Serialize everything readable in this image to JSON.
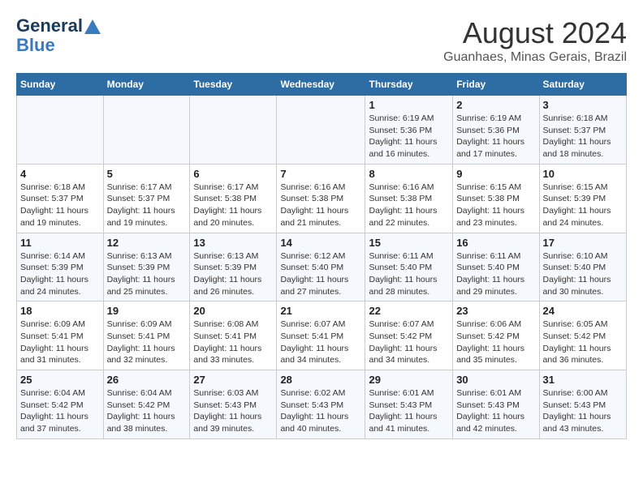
{
  "header": {
    "logo_line1": "General",
    "logo_line2": "Blue",
    "title": "August 2024",
    "subtitle": "Guanhaes, Minas Gerais, Brazil"
  },
  "days_of_week": [
    "Sunday",
    "Monday",
    "Tuesday",
    "Wednesday",
    "Thursday",
    "Friday",
    "Saturday"
  ],
  "weeks": [
    [
      {
        "day": "",
        "info": ""
      },
      {
        "day": "",
        "info": ""
      },
      {
        "day": "",
        "info": ""
      },
      {
        "day": "",
        "info": ""
      },
      {
        "day": "1",
        "info": "Sunrise: 6:19 AM\nSunset: 5:36 PM\nDaylight: 11 hours and 16 minutes."
      },
      {
        "day": "2",
        "info": "Sunrise: 6:19 AM\nSunset: 5:36 PM\nDaylight: 11 hours and 17 minutes."
      },
      {
        "day": "3",
        "info": "Sunrise: 6:18 AM\nSunset: 5:37 PM\nDaylight: 11 hours and 18 minutes."
      }
    ],
    [
      {
        "day": "4",
        "info": "Sunrise: 6:18 AM\nSunset: 5:37 PM\nDaylight: 11 hours and 19 minutes."
      },
      {
        "day": "5",
        "info": "Sunrise: 6:17 AM\nSunset: 5:37 PM\nDaylight: 11 hours and 19 minutes."
      },
      {
        "day": "6",
        "info": "Sunrise: 6:17 AM\nSunset: 5:38 PM\nDaylight: 11 hours and 20 minutes."
      },
      {
        "day": "7",
        "info": "Sunrise: 6:16 AM\nSunset: 5:38 PM\nDaylight: 11 hours and 21 minutes."
      },
      {
        "day": "8",
        "info": "Sunrise: 6:16 AM\nSunset: 5:38 PM\nDaylight: 11 hours and 22 minutes."
      },
      {
        "day": "9",
        "info": "Sunrise: 6:15 AM\nSunset: 5:38 PM\nDaylight: 11 hours and 23 minutes."
      },
      {
        "day": "10",
        "info": "Sunrise: 6:15 AM\nSunset: 5:39 PM\nDaylight: 11 hours and 24 minutes."
      }
    ],
    [
      {
        "day": "11",
        "info": "Sunrise: 6:14 AM\nSunset: 5:39 PM\nDaylight: 11 hours and 24 minutes."
      },
      {
        "day": "12",
        "info": "Sunrise: 6:13 AM\nSunset: 5:39 PM\nDaylight: 11 hours and 25 minutes."
      },
      {
        "day": "13",
        "info": "Sunrise: 6:13 AM\nSunset: 5:39 PM\nDaylight: 11 hours and 26 minutes."
      },
      {
        "day": "14",
        "info": "Sunrise: 6:12 AM\nSunset: 5:40 PM\nDaylight: 11 hours and 27 minutes."
      },
      {
        "day": "15",
        "info": "Sunrise: 6:11 AM\nSunset: 5:40 PM\nDaylight: 11 hours and 28 minutes."
      },
      {
        "day": "16",
        "info": "Sunrise: 6:11 AM\nSunset: 5:40 PM\nDaylight: 11 hours and 29 minutes."
      },
      {
        "day": "17",
        "info": "Sunrise: 6:10 AM\nSunset: 5:40 PM\nDaylight: 11 hours and 30 minutes."
      }
    ],
    [
      {
        "day": "18",
        "info": "Sunrise: 6:09 AM\nSunset: 5:41 PM\nDaylight: 11 hours and 31 minutes."
      },
      {
        "day": "19",
        "info": "Sunrise: 6:09 AM\nSunset: 5:41 PM\nDaylight: 11 hours and 32 minutes."
      },
      {
        "day": "20",
        "info": "Sunrise: 6:08 AM\nSunset: 5:41 PM\nDaylight: 11 hours and 33 minutes."
      },
      {
        "day": "21",
        "info": "Sunrise: 6:07 AM\nSunset: 5:41 PM\nDaylight: 11 hours and 34 minutes."
      },
      {
        "day": "22",
        "info": "Sunrise: 6:07 AM\nSunset: 5:42 PM\nDaylight: 11 hours and 34 minutes."
      },
      {
        "day": "23",
        "info": "Sunrise: 6:06 AM\nSunset: 5:42 PM\nDaylight: 11 hours and 35 minutes."
      },
      {
        "day": "24",
        "info": "Sunrise: 6:05 AM\nSunset: 5:42 PM\nDaylight: 11 hours and 36 minutes."
      }
    ],
    [
      {
        "day": "25",
        "info": "Sunrise: 6:04 AM\nSunset: 5:42 PM\nDaylight: 11 hours and 37 minutes."
      },
      {
        "day": "26",
        "info": "Sunrise: 6:04 AM\nSunset: 5:42 PM\nDaylight: 11 hours and 38 minutes."
      },
      {
        "day": "27",
        "info": "Sunrise: 6:03 AM\nSunset: 5:43 PM\nDaylight: 11 hours and 39 minutes."
      },
      {
        "day": "28",
        "info": "Sunrise: 6:02 AM\nSunset: 5:43 PM\nDaylight: 11 hours and 40 minutes."
      },
      {
        "day": "29",
        "info": "Sunrise: 6:01 AM\nSunset: 5:43 PM\nDaylight: 11 hours and 41 minutes."
      },
      {
        "day": "30",
        "info": "Sunrise: 6:01 AM\nSunset: 5:43 PM\nDaylight: 11 hours and 42 minutes."
      },
      {
        "day": "31",
        "info": "Sunrise: 6:00 AM\nSunset: 5:43 PM\nDaylight: 11 hours and 43 minutes."
      }
    ]
  ]
}
